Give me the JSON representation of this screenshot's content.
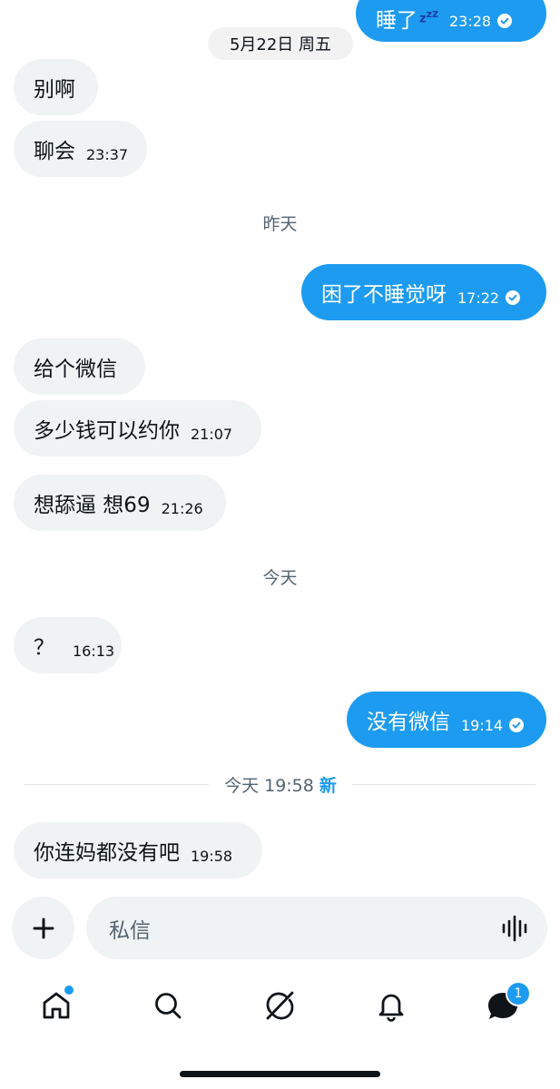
{
  "date_separator": "5月22日 周五",
  "day_labels": {
    "yesterday": "昨天",
    "today": "今天"
  },
  "new_divider": {
    "time": "今天 19:58",
    "new_tag": "新"
  },
  "messages": [
    {
      "direction": "out",
      "text": "睡了",
      "time": "23:28",
      "read": true
    },
    {
      "direction": "in",
      "text": "别啊",
      "time": ""
    },
    {
      "direction": "in",
      "text": "聊会",
      "time": "23:37"
    },
    {
      "direction": "out",
      "text": "困了不睡觉呀",
      "time": "17:22",
      "read": true
    },
    {
      "direction": "in",
      "text": "给个微信",
      "time": ""
    },
    {
      "direction": "in",
      "text": "多少钱可以约你",
      "time": "21:07"
    },
    {
      "direction": "in",
      "text": "想舔逼 想69",
      "time": "21:26"
    },
    {
      "direction": "in",
      "text": "？",
      "time": "16:13"
    },
    {
      "direction": "out",
      "text": "没有微信",
      "time": "19:14",
      "read": true
    },
    {
      "direction": "in",
      "text": "你连妈都没有吧",
      "time": "19:58"
    }
  ],
  "composer": {
    "placeholder": "私信",
    "add_icon": "plus-icon",
    "voice_icon": "voice-wave-icon"
  },
  "tabbar": {
    "items": [
      {
        "icon": "home-icon",
        "dot": true
      },
      {
        "icon": "search-icon"
      },
      {
        "icon": "grok-icon"
      },
      {
        "icon": "bell-icon"
      },
      {
        "icon": "messages-icon",
        "badge": "1"
      }
    ]
  },
  "colors": {
    "accent": "#1d9bf0",
    "incoming_bubble": "#eff3f4",
    "text": "#0f1419",
    "muted": "#536471"
  }
}
